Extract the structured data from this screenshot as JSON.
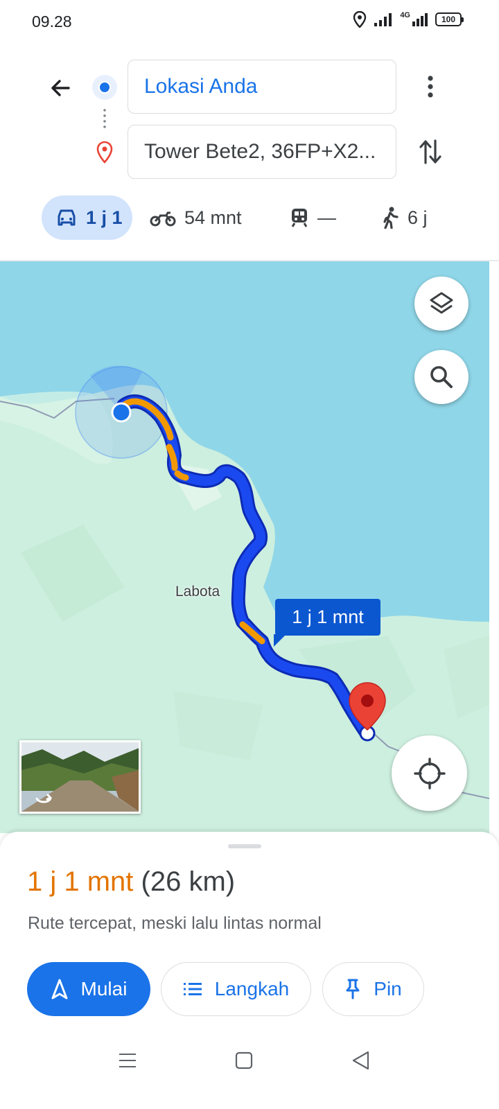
{
  "status_bar": {
    "time": "09.28",
    "network": "4G",
    "battery": "100"
  },
  "route": {
    "origin": "Lokasi Anda",
    "destination": "Tower Bete2, 36FP+X2..."
  },
  "modes": {
    "car": "1 j 1",
    "motorcycle": "54 mnt",
    "transit": "—",
    "walk": "6 j"
  },
  "map": {
    "place_label": "Labota",
    "duration_callout": "1 j 1 mnt"
  },
  "summary": {
    "duration": "1 j 1 mnt",
    "distance": "(26 km)",
    "description": "Rute tercepat, meski lalu lintas normal"
  },
  "actions": {
    "start_label": "Mulai",
    "steps_label": "Langkah",
    "pin_label": "Pin"
  },
  "colors": {
    "accent_blue": "#1a73e8",
    "route_blue": "#1a49f0",
    "traffic_orange": "#f29900",
    "duration_orange": "#e37400",
    "map_water": "#8fd6e8",
    "map_land": "#cdefdf",
    "pin_red": "#ea4335"
  }
}
